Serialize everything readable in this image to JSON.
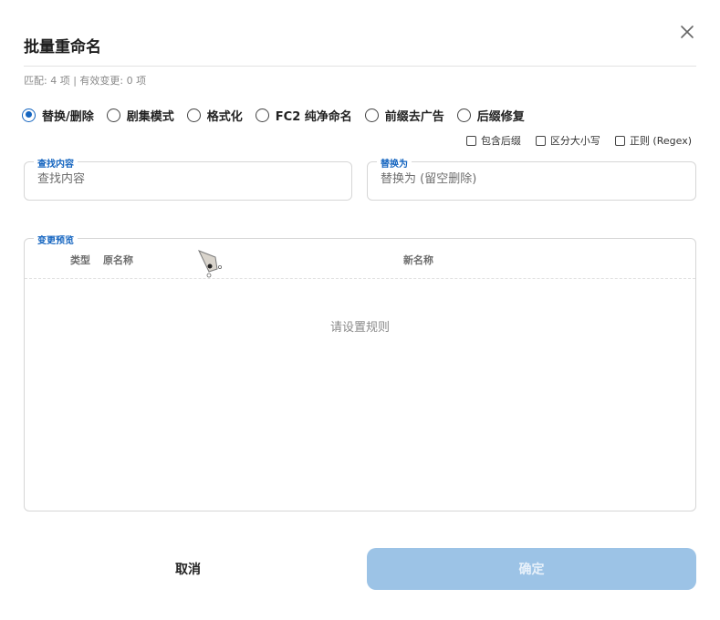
{
  "dialog": {
    "title": "批量重命名",
    "match_info": "匹配: 4 项 | 有效变更: 0 项"
  },
  "modes": [
    {
      "label": "替换/删除",
      "checked": true
    },
    {
      "label": "剧集模式",
      "checked": false
    },
    {
      "label": "格式化",
      "checked": false
    },
    {
      "label": "FC2 纯净命名",
      "checked": false
    },
    {
      "label": "前缀去广告",
      "checked": false
    },
    {
      "label": "后缀修复",
      "checked": false
    }
  ],
  "options": {
    "include_suffix": "包含后缀",
    "case_sensitive": "区分大小写",
    "regex": "正则 (Regex)"
  },
  "find": {
    "legend": "查找内容",
    "placeholder": "查找内容",
    "value": ""
  },
  "replace": {
    "legend": "替换为",
    "placeholder": "替换为 (留空删除)",
    "value": ""
  },
  "preview": {
    "legend": "变更预览",
    "columns": {
      "type": "类型",
      "original": "原名称",
      "new": "新名称"
    },
    "empty_text": "请设置规则"
  },
  "buttons": {
    "cancel": "取消",
    "confirm": "确定"
  },
  "colors": {
    "accent": "#1565c0",
    "confirm_disabled": "#9cc3e6"
  },
  "icons": {
    "close": "close-icon",
    "cursor": "mouse-cursor-icon"
  }
}
